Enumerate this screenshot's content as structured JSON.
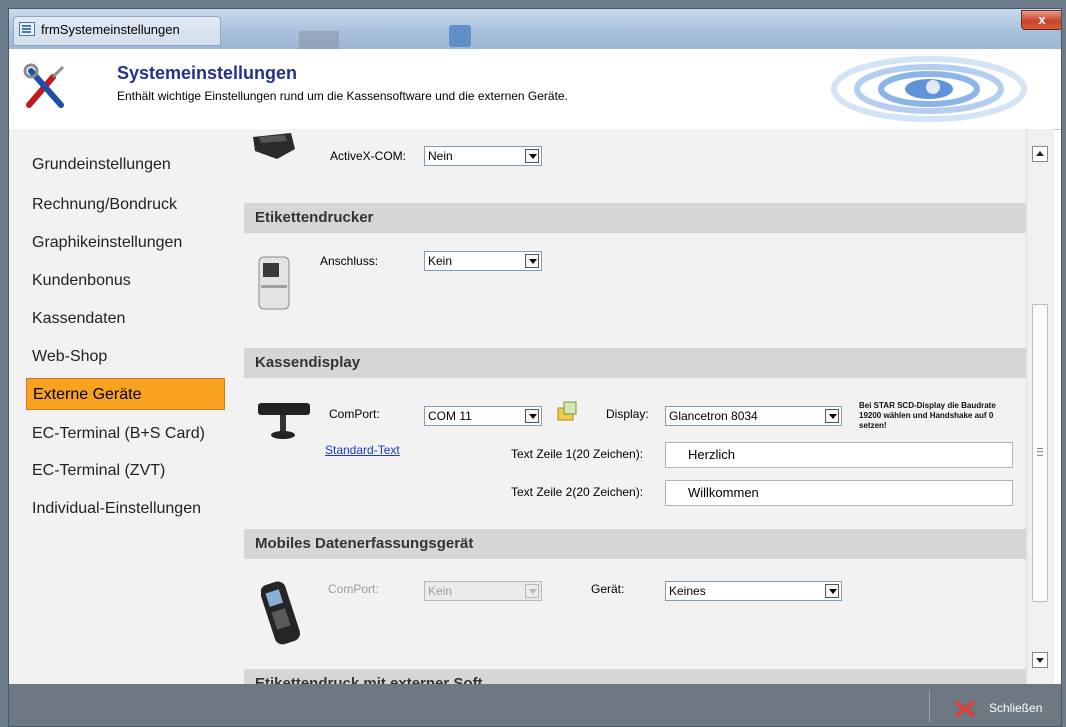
{
  "window": {
    "title": "frmSystemeinstellungen",
    "close_label": "x"
  },
  "header": {
    "title": "Systemeinstellungen",
    "subtitle": "Enthält wichtige Einstellungen rund um die Kassensoftware und die externen Geräte."
  },
  "nav": {
    "items": [
      {
        "label": "Grundeinstellungen"
      },
      {
        "label": "Rechnung/Bondruck"
      },
      {
        "label": "Graphikeinstellungen"
      },
      {
        "label": "Kundenbonus"
      },
      {
        "label": "Kassendaten"
      },
      {
        "label": "Web-Shop"
      },
      {
        "label": "Externe Geräte"
      },
      {
        "label": "EC-Terminal (B+S Card)"
      },
      {
        "label": "EC-Terminal (ZVT)"
      },
      {
        "label": "Individual-Einstellungen"
      }
    ],
    "active": "Externe Geräte"
  },
  "bondrucker": {
    "activex_label": "ActiveX-COM:",
    "activex_value": "Nein"
  },
  "etikettendrucker": {
    "heading": "Etikettendrucker",
    "anschluss_label": "Anschluss:",
    "anschluss_value": "Kein"
  },
  "kassendisplay": {
    "heading": "Kassendisplay",
    "comport_label": "ComPort:",
    "comport_value": "COM 11",
    "display_label": "Display:",
    "display_value": "Glancetron 8034",
    "note": "Bei STAR SCD-Display die Baudrate 19200 wählen und Handshake auf 0 setzen!",
    "standard_link": "Standard-Text",
    "line1_label": "Text Zeile 1(20 Zeichen):",
    "line1_value": "Herzlich",
    "line2_label": "Text Zeile 2(20 Zeichen):",
    "line2_value": "Willkommen"
  },
  "mobil": {
    "heading": "Mobiles Datenerfassungsgerät",
    "comport_label": "ComPort:",
    "comport_value": "Kein",
    "geraet_label": "Gerät:",
    "geraet_value": "Keines"
  },
  "next_section": {
    "heading": "Etikettendruck mit externer Soft"
  },
  "footer": {
    "close_label": "Schließen"
  },
  "colors": {
    "active_nav": "#f8a21f",
    "title_blue": "#23318f",
    "link_blue": "#1c39c0",
    "close_red": "#d9413a"
  }
}
